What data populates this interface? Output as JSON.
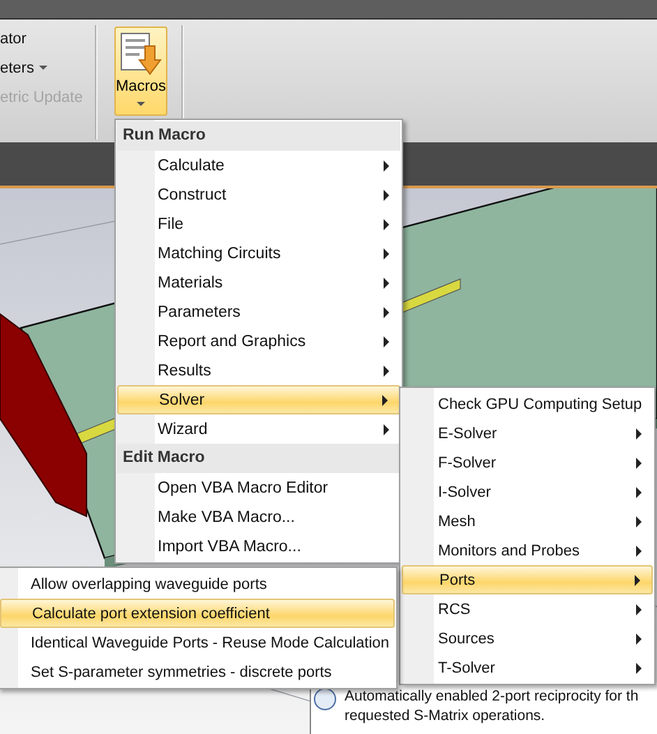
{
  "ribbon": {
    "group_items": [
      {
        "label": "ator",
        "disabled": false,
        "dropdown": false
      },
      {
        "label": "eters",
        "disabled": false,
        "dropdown": true
      },
      {
        "label": "etric Update",
        "disabled": true,
        "dropdown": false
      }
    ],
    "macros_button": {
      "label": "Macros",
      "active": true
    }
  },
  "macro_menu": {
    "sections": [
      {
        "header": "Run Macro",
        "items": [
          {
            "label": "Calculate",
            "submenu": true,
            "selected": false
          },
          {
            "label": "Construct",
            "submenu": true,
            "selected": false
          },
          {
            "label": "File",
            "submenu": true,
            "selected": false
          },
          {
            "label": "Matching Circuits",
            "submenu": true,
            "selected": false
          },
          {
            "label": "Materials",
            "submenu": true,
            "selected": false
          },
          {
            "label": "Parameters",
            "submenu": true,
            "selected": false
          },
          {
            "label": "Report and Graphics",
            "submenu": true,
            "selected": false
          },
          {
            "label": "Results",
            "submenu": true,
            "selected": false
          },
          {
            "label": "Solver",
            "submenu": true,
            "selected": true
          },
          {
            "label": "Wizard",
            "submenu": true,
            "selected": false
          }
        ]
      },
      {
        "header": "Edit Macro",
        "items": [
          {
            "label": "Open VBA Macro Editor",
            "submenu": false,
            "selected": false
          },
          {
            "label": "Make VBA Macro...",
            "submenu": false,
            "selected": false
          },
          {
            "label": "Import VBA Macro...",
            "submenu": false,
            "selected": false
          }
        ]
      }
    ]
  },
  "solver_submenu": {
    "items": [
      {
        "label": "Check GPU Computing Setup",
        "submenu": false,
        "selected": false
      },
      {
        "label": "E-Solver",
        "submenu": true,
        "selected": false
      },
      {
        "label": "F-Solver",
        "submenu": true,
        "selected": false
      },
      {
        "label": "I-Solver",
        "submenu": true,
        "selected": false
      },
      {
        "label": "Mesh",
        "submenu": true,
        "selected": false
      },
      {
        "label": "Monitors and Probes",
        "submenu": true,
        "selected": false
      },
      {
        "label": "Ports",
        "submenu": true,
        "selected": true
      },
      {
        "label": "RCS",
        "submenu": true,
        "selected": false
      },
      {
        "label": "Sources",
        "submenu": true,
        "selected": false
      },
      {
        "label": "T-Solver",
        "submenu": true,
        "selected": false
      }
    ]
  },
  "ports_submenu": {
    "items": [
      {
        "label": "Allow overlapping waveguide ports",
        "submenu": false,
        "selected": false
      },
      {
        "label": "Calculate port extension coefficient",
        "submenu": false,
        "selected": true
      },
      {
        "label": "Identical Waveguide Ports - Reuse Mode Calculation",
        "submenu": false,
        "selected": false
      },
      {
        "label": "Set S-parameter symmetries - discrete ports",
        "submenu": false,
        "selected": false
      }
    ]
  },
  "messages": [
    {
      "lines": [
        "Automatically enabled 2-port reciprocity for th",
        "requested S-Matrix operations."
      ]
    }
  ]
}
